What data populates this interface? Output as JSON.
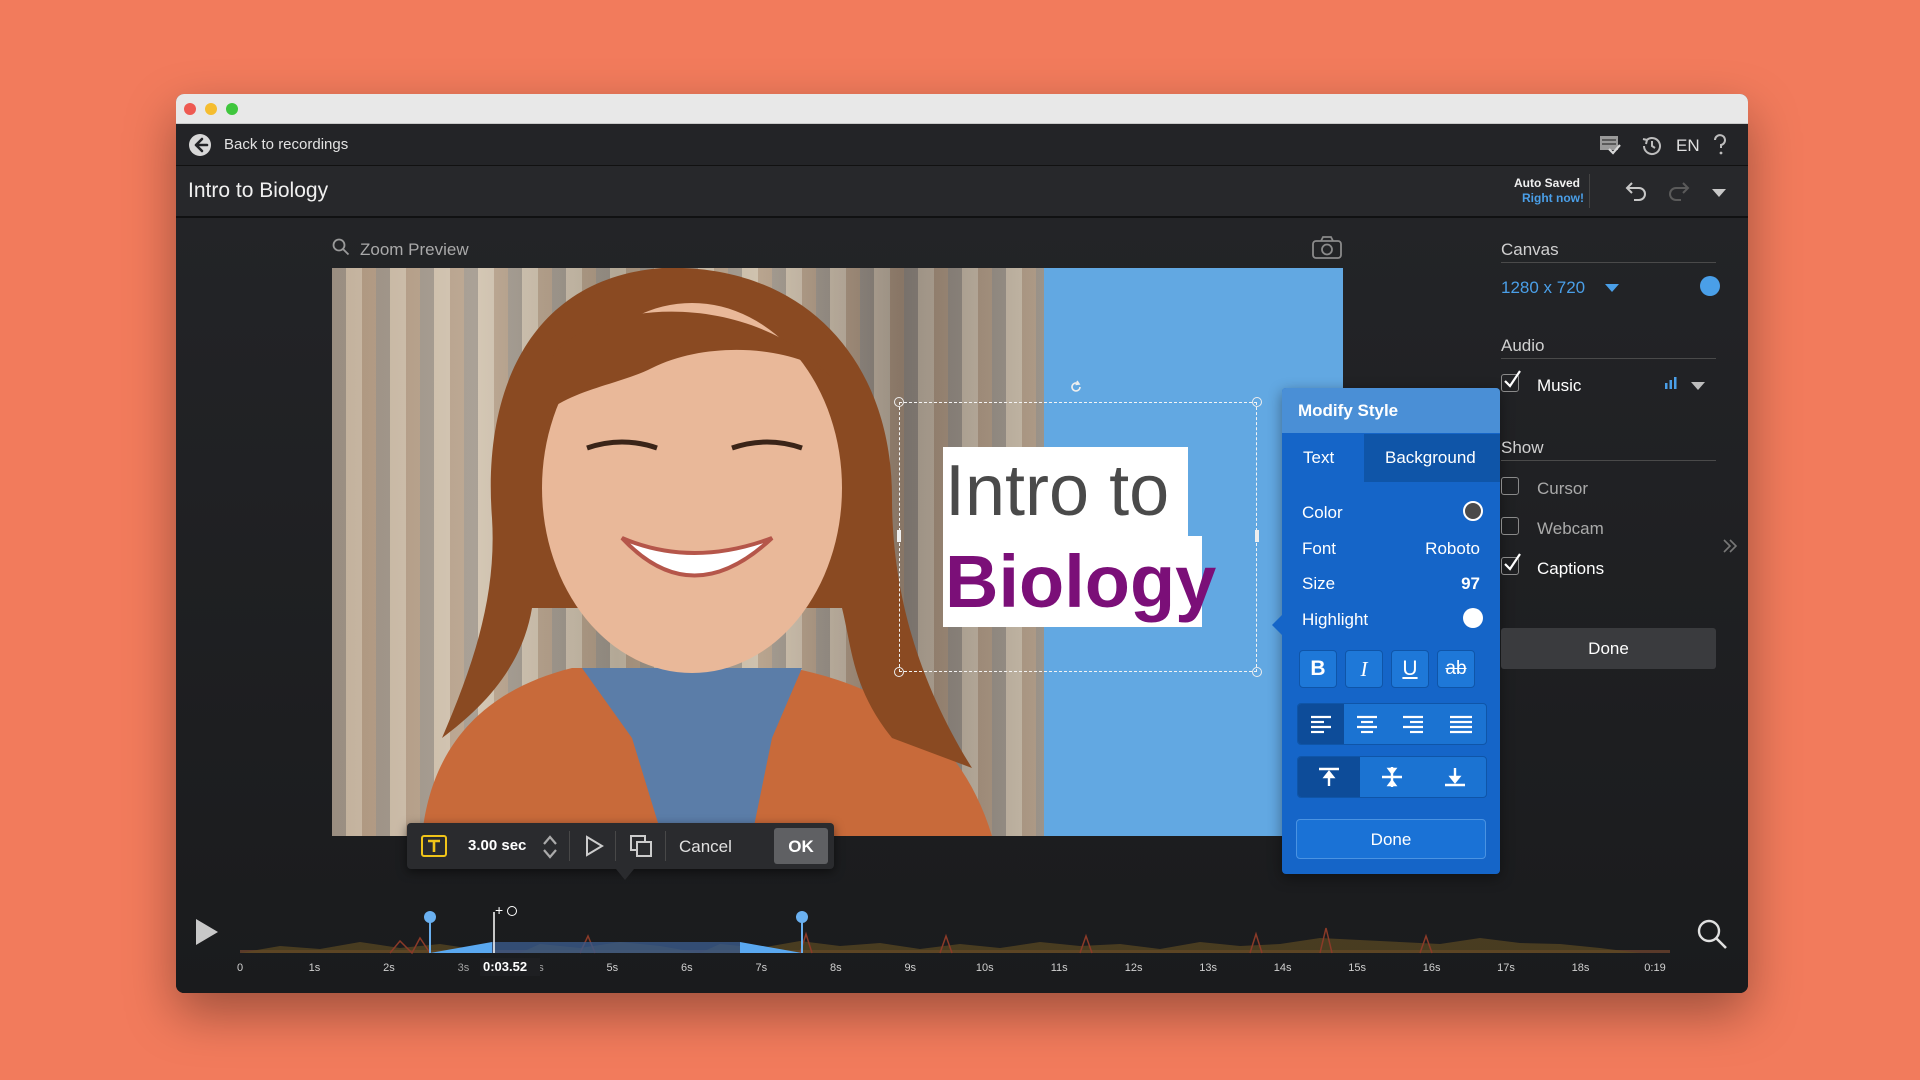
{
  "nav": {
    "back_label": "Back to recordings",
    "language": "EN"
  },
  "header": {
    "project_title": "Intro to Biology",
    "auto_saved": "Auto Saved",
    "saved_time": "Right now!"
  },
  "preview": {
    "zoom_label": "Zoom Preview",
    "caption_line1": "Intro to",
    "caption_line2": "Biology"
  },
  "modify_style": {
    "title": "Modify Style",
    "tabs": [
      "Text",
      "Background"
    ],
    "color_label": "Color",
    "font_label": "Font",
    "font_value": "Roboto",
    "size_label": "Size",
    "size_value": "97",
    "highlight_label": "Highlight",
    "done_label": "Done"
  },
  "sidebar": {
    "canvas_heading": "Canvas",
    "canvas_size": "1280 x 720",
    "audio_heading": "Audio",
    "music_label": "Music",
    "show_heading": "Show",
    "cursor_label": "Cursor",
    "webcam_label": "Webcam",
    "captions_label": "Captions",
    "done_label": "Done",
    "music_checked": true,
    "cursor_checked": false,
    "webcam_checked": false,
    "captions_checked": true
  },
  "clip_toolbar": {
    "duration": "3.00 sec",
    "cancel_label": "Cancel",
    "ok_label": "OK"
  },
  "timeline": {
    "current_time": "0:03.52",
    "add_marker": "+",
    "ticks": [
      "0",
      "1s",
      "2s",
      "3s",
      "4s",
      "5s",
      "6s",
      "7s",
      "8s",
      "9s",
      "10s",
      "11s",
      "12s",
      "13s",
      "14s",
      "15s",
      "16s",
      "17s",
      "18s",
      "0:19"
    ]
  },
  "colors": {
    "background": "#f27b5c",
    "accent_blue": "#1565c8",
    "canvas_blue": "#62a8e2",
    "caption_purple": "#7b0f78",
    "link_blue": "#4a9fe8"
  }
}
